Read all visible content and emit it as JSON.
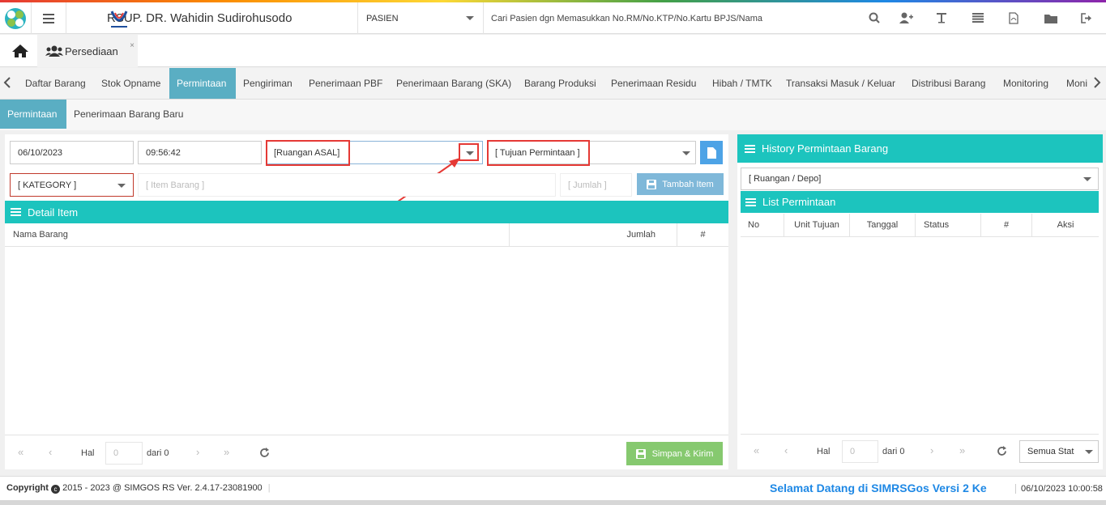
{
  "header": {
    "hospital_name": "RSUP. DR. Wahidin Sudirohusodo",
    "search_type": "PASIEN",
    "search_placeholder": "Cari Pasien dgn Memasukkan No.RM/No.KTP/No.Kartu BPJS/Nama",
    "icons": [
      "search-icon",
      "add-user-icon",
      "text-icon",
      "list-icon",
      "pdf-icon",
      "folder-icon",
      "logout-icon"
    ]
  },
  "app_tab": {
    "label": "Persediaan",
    "close": "×"
  },
  "module_tabs": [
    "Daftar Barang",
    "Stok Opname",
    "Permintaan",
    "Pengiriman",
    "Penerimaan PBF",
    "Penerimaan Barang (SKA)",
    "Barang Produksi",
    "Penerimaan Residu",
    "Hibah / TMTK",
    "Transaksi Masuk / Keluar",
    "Distribusi Barang",
    "Monitoring",
    "Moni"
  ],
  "sub_tabs": [
    "Permintaan",
    "Penerimaan Barang Baru"
  ],
  "form": {
    "date": "06/10/2023",
    "time": "09:56:42",
    "ruangan_asal": "[Ruangan ASAL]",
    "tujuan": "[ Tujuan Permintaan ]",
    "kategori": "[ KATEGORY ]",
    "item_placeholder": "[ Item Barang ]",
    "jumlah_placeholder": "[ Jumlah ]",
    "tambah_label": "Tambah Item"
  },
  "detail": {
    "title": "Detail Item",
    "columns": [
      "Nama Barang",
      "Jumlah",
      "#"
    ]
  },
  "pager_left": {
    "hal": "Hal",
    "page": "0",
    "dari": "dari 0",
    "submit": "Simpan & Kirim"
  },
  "history": {
    "title": "History Permintaan Barang",
    "ruangan": "[ Ruangan / Depo]",
    "list_title": "List Permintaan",
    "columns": [
      "No",
      "Unit Tujuan",
      "Tanggal",
      "Status",
      "#",
      "Aksi"
    ]
  },
  "pager_right": {
    "hal": "Hal",
    "page": "0",
    "dari": "dari 0",
    "status": "Semua Stat"
  },
  "footer": {
    "copyright_bold": "Copyright",
    "copyright": "2015 - 2023 @ SIMGOS RS Ver. 2.4.17-23081900",
    "welcome": "Selamat Datang di SIMRSGos Versi 2 Ke",
    "datetime": "06/10/2023 10:00:58"
  }
}
